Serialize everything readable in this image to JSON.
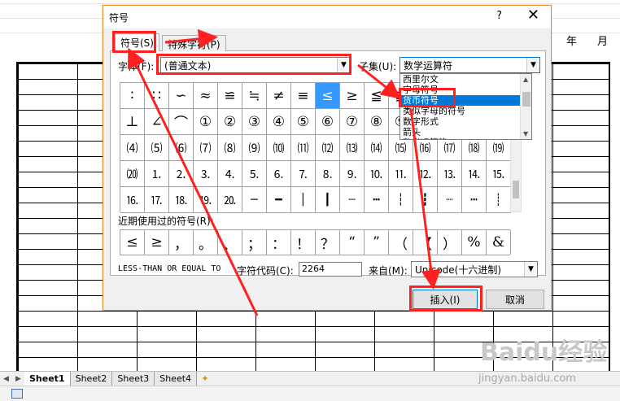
{
  "spreadsheet": {
    "header_year": "年",
    "header_month": "月",
    "sheet_tabs": [
      "Sheet1",
      "Sheet2",
      "Sheet3",
      "Sheet4"
    ]
  },
  "dialog": {
    "title": "符号",
    "help": "?",
    "close": "✕",
    "tabs": [
      "符号(S)",
      "特殊字符(P)"
    ],
    "font_label": "字体(F):",
    "font_value": "(普通文本)",
    "subset_label": "子集(U):",
    "subset_value": "数学运算符",
    "subset_options": [
      "西里尔文",
      "字母符号",
      "货币符号",
      "类似字母的符号",
      "数字形式",
      "箭头",
      "数学运算符"
    ],
    "subset_selected": "货币符号",
    "symbol_rows": [
      [
        "∶",
        "∷",
        "∽",
        "≈",
        "≌",
        "≒",
        "≠",
        "≡",
        "≤",
        "≥",
        "≦",
        "≧",
        "≮",
        "≯",
        "⊕",
        "⊙"
      ],
      [
        "⊥",
        "∠",
        "⌒",
        "①",
        "②",
        "③",
        "④",
        "⑤",
        "⑥",
        "⑦",
        "⑧",
        "⑨",
        "⑩",
        "⑪",
        "⑫",
        "⑬"
      ],
      [
        "⑷",
        "⑸",
        "⑹",
        "⑺",
        "⑻",
        "⑼",
        "⑽",
        "⑾",
        "⑿",
        "⒀",
        "⒁",
        "⒂",
        "⒃",
        "⒄",
        "⒅",
        "⒆"
      ],
      [
        "⒇",
        "⒈",
        "⒉",
        "⒊",
        "⒋",
        "⒌",
        "⒍",
        "⒎",
        "⒏",
        "⒐",
        "⒑",
        "⒒",
        "⒓",
        "⒔",
        "⒕",
        "⒖"
      ],
      [
        "⒗",
        "⒘",
        "⒙",
        "⒚",
        "⒛",
        "─",
        "━",
        "│",
        "┃",
        "┄",
        "┅",
        "┆",
        "┇",
        "┈",
        "┉",
        "┊"
      ]
    ],
    "recent_label": "近期使用过的符号(R):",
    "recent_symbols": [
      "≤",
      "≥",
      "，",
      "。",
      "、",
      "；",
      "：",
      "！",
      "？",
      "“",
      "”",
      "（",
      "【",
      "）",
      "%",
      "&"
    ],
    "char_name": "LESS-THAN OR EQUAL TO",
    "char_code_label": "字符代码(C):",
    "char_code": "2264",
    "from_label": "来自(M):",
    "from_value": "Unicode(十六进制)",
    "insert_button": "插入(I)",
    "cancel_button": "取消"
  },
  "watermark": {
    "brand": "Baidu经验",
    "url": "jingyan.baidu.com"
  },
  "colors": {
    "highlight": "#ff2020",
    "selection": "#3399ff",
    "dropdown_selection": "#0078d7"
  }
}
